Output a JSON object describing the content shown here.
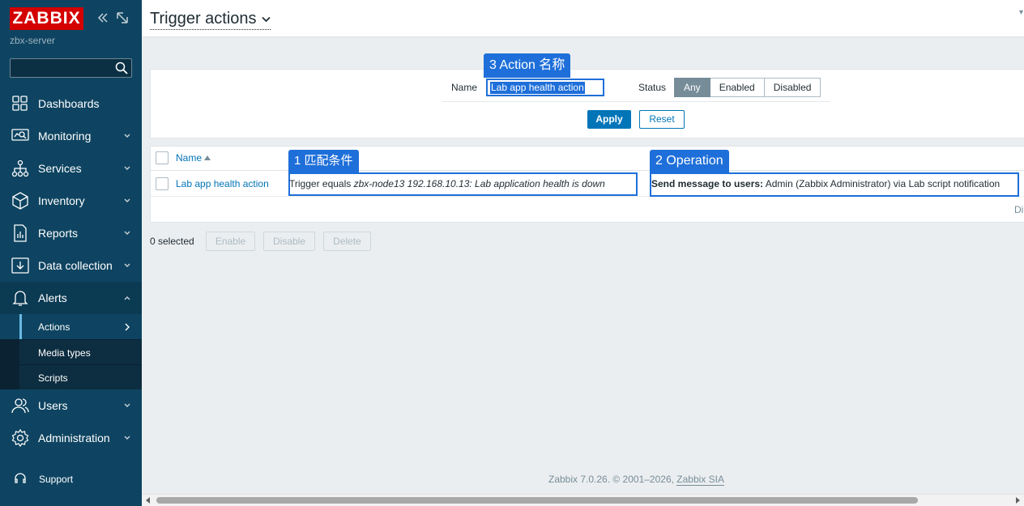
{
  "sidebar": {
    "logo": "ZABBIX",
    "server": "zbx-server",
    "search_placeholder": "",
    "items": [
      {
        "label": "Dashboards",
        "icon": "dashboards-icon"
      },
      {
        "label": "Monitoring",
        "icon": "monitoring-icon"
      },
      {
        "label": "Services",
        "icon": "services-icon"
      },
      {
        "label": "Inventory",
        "icon": "inventory-icon"
      },
      {
        "label": "Reports",
        "icon": "reports-icon"
      },
      {
        "label": "Data collection",
        "icon": "data-collection-icon"
      },
      {
        "label": "Alerts",
        "icon": "bell-icon"
      },
      {
        "label": "Users",
        "icon": "users-icon"
      },
      {
        "label": "Administration",
        "icon": "gear-icon"
      }
    ],
    "alerts_sub": [
      {
        "label": "Actions"
      },
      {
        "label": "Media types"
      },
      {
        "label": "Scripts"
      }
    ],
    "support": "Support"
  },
  "header": {
    "title": "Trigger actions"
  },
  "filter": {
    "name_label": "Name",
    "name_value": "Lab app health action",
    "status_label": "Status",
    "status_options": [
      "Any",
      "Enabled",
      "Disabled"
    ],
    "status_selected": "Any",
    "apply": "Apply",
    "reset": "Reset"
  },
  "table": {
    "col_name": "Name",
    "rows": [
      {
        "name": "Lab app health action",
        "cond_prefix": "Trigger equals ",
        "cond_trigger": "zbx-node13 192.168.10.13: Lab application health is down",
        "op_bold": "Send message to users:",
        "op_rest": " Admin (Zabbix Administrator) via Lab script notification"
      }
    ],
    "display_text": "Di"
  },
  "callouts": {
    "c1": "1 匹配条件",
    "c2": "2 Operation",
    "c3": "3 Action 名称"
  },
  "mass": {
    "selected": "0 selected",
    "enable": "Enable",
    "disable": "Disable",
    "delete": "Delete"
  },
  "footer": {
    "text": "Zabbix 7.0.26. © 2001–2026, ",
    "link": "Zabbix SIA"
  }
}
